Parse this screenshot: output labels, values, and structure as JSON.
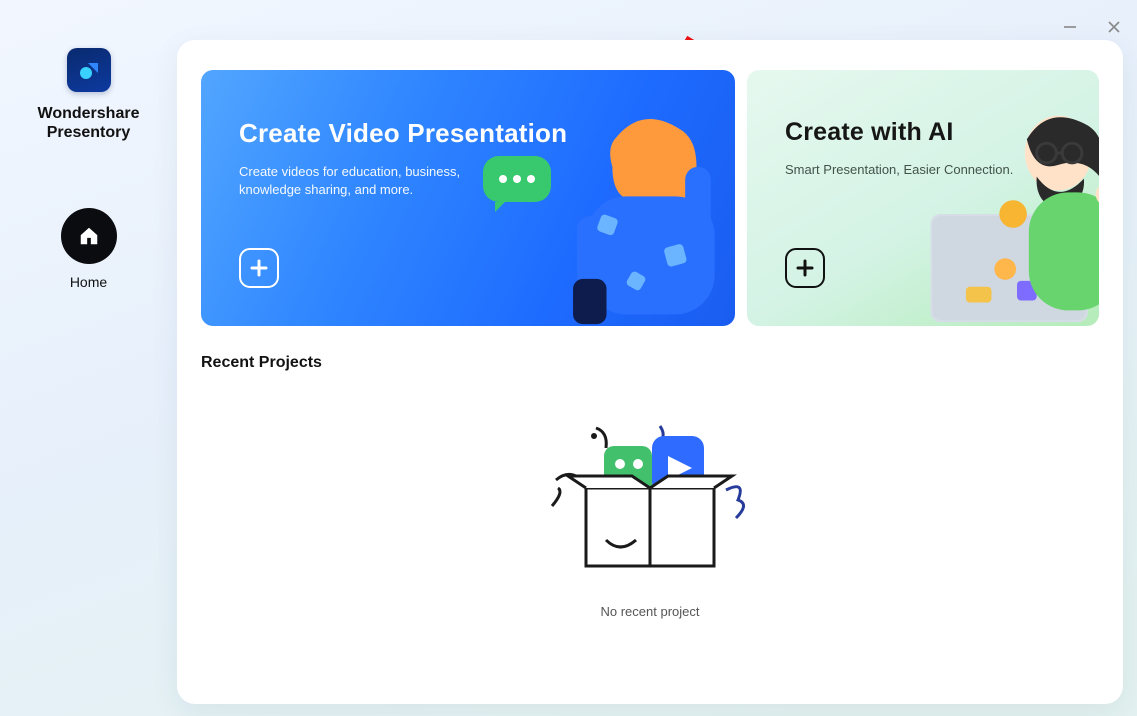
{
  "brand": {
    "line1": "Wondershare",
    "line2": "Presentory"
  },
  "nav": {
    "home": "Home"
  },
  "cards": {
    "video": {
      "title": "Create Video Presentation",
      "desc": "Create videos for education, business, knowledge sharing, and more."
    },
    "ai": {
      "title": "Create with AI",
      "desc": "Smart Presentation, Easier Connection."
    }
  },
  "recent": {
    "heading": "Recent Projects",
    "empty_message": "No recent project"
  }
}
